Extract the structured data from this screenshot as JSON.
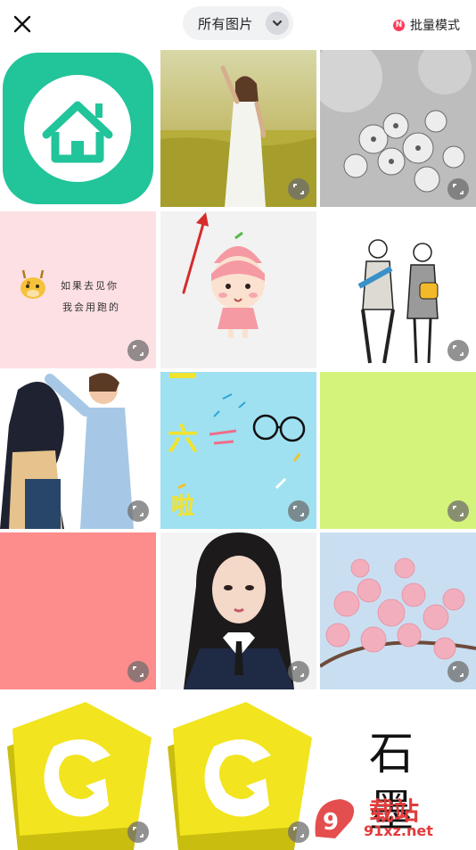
{
  "header": {
    "close_icon": "close-icon",
    "album_label": "所有图片",
    "album_chevron_icon": "chevron-down-icon",
    "batch_badge": "N",
    "batch_label": "批量模式"
  },
  "tiles": [
    {
      "name": "home-app-icon-image"
    },
    {
      "name": "girl-in-field-photo"
    },
    {
      "name": "grey-blossom-photo"
    },
    {
      "name": "giraffe-quote-card",
      "text_line1": "如果去见你",
      "text_line2": "我会用跑的"
    },
    {
      "name": "cartoon-peach-girl"
    },
    {
      "name": "couple-illustration"
    },
    {
      "name": "romantic-couple-illustration"
    },
    {
      "name": "children-day-card",
      "text_six": "六",
      "text_la": "啦"
    },
    {
      "name": "green-solid-color"
    },
    {
      "name": "red-solid-color"
    },
    {
      "name": "girl-portrait-photo"
    },
    {
      "name": "cherry-blossom-photo"
    },
    {
      "name": "yellow-g-logo-1"
    },
    {
      "name": "yellow-g-logo-2"
    },
    {
      "name": "graphite-text-image",
      "text_line1": "石",
      "text_line2": "墨"
    }
  ],
  "watermark": {
    "line1": "载站",
    "line2": "91xz.net"
  },
  "colors": {
    "pink_card": "#fde0e4",
    "sky_card": "#9fe1f1",
    "green_card": "#d4f37a",
    "red_card": "#fd8c8c",
    "app_green": "#22c49a"
  }
}
